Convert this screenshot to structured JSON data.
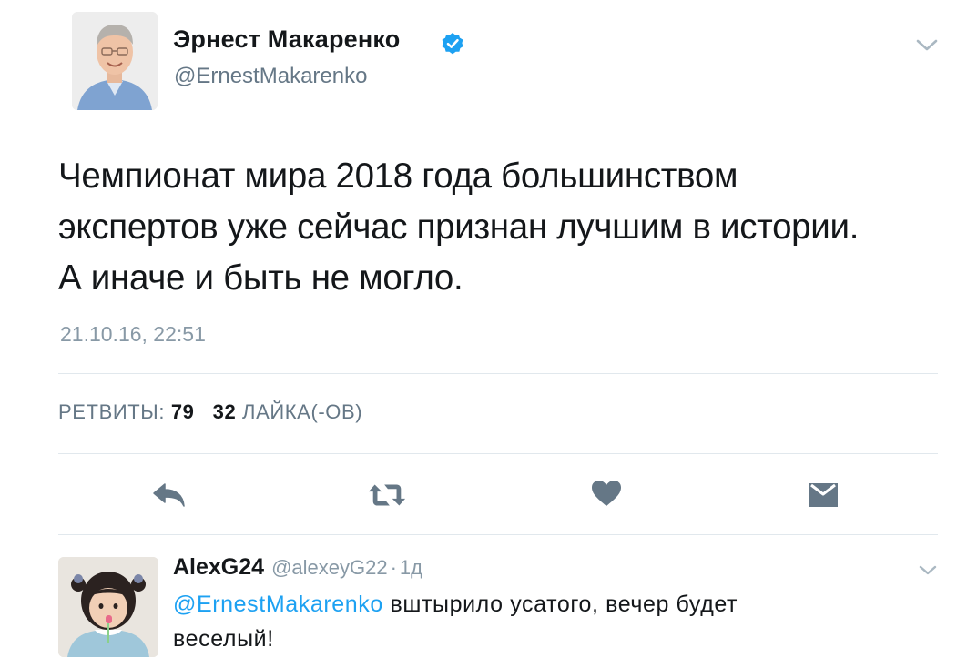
{
  "tweet": {
    "author": {
      "name": "Эрнест Макаренко",
      "handle": "@ErnestMakarenko",
      "verified": true,
      "avatar_icon": "person-photo-avatar"
    },
    "text_lines": [
      "Чемпионат мира 2018 года большинством",
      "экспертов уже сейчас признан лучшим в истории.",
      "А иначе и быть не могло."
    ],
    "timestamp": "21.10.16, 22:51",
    "stats": {
      "retweets_label": "РЕТВИТЫ:",
      "retweets_count": "79",
      "likes_count": "32",
      "likes_label": "ЛАЙКА(-ОВ)"
    },
    "actions": {
      "reply_icon": "reply-arrow-icon",
      "retweet_icon": "retweet-icon",
      "like_icon": "heart-icon",
      "dm_icon": "envelope-icon"
    },
    "menu_icon": "chevron-down-icon"
  },
  "reply": {
    "name": "AlexG24",
    "handle": "@alexeyG22",
    "separator": "·",
    "time": "1д",
    "mention": "@ErnestMakarenko",
    "text_rest_line1": " вштырило усатого, вечер будет",
    "text_line2": "веселый!",
    "avatar_icon": "child-photo-avatar",
    "menu_icon": "chevron-down-icon"
  },
  "colors": {
    "accent": "#1da1f2",
    "text": "#14171a",
    "secondary": "#657786",
    "muted": "#8899a6",
    "divider": "#e1e8ed",
    "icon": "#657786"
  }
}
